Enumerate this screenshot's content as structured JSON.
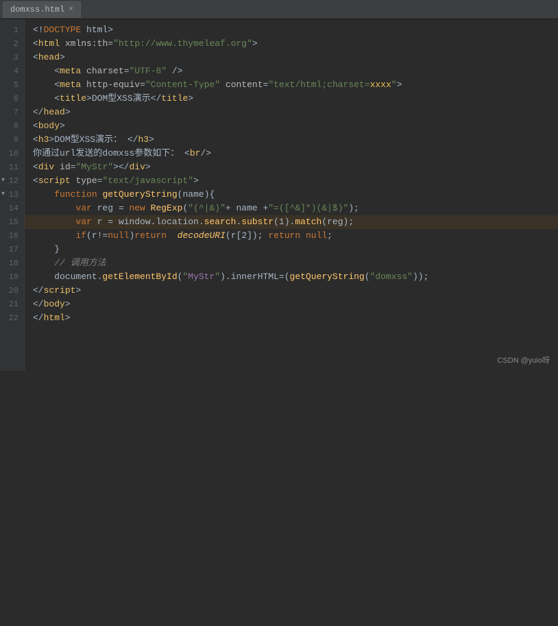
{
  "tab": {
    "filename": "domxss.html",
    "close": "×"
  },
  "lines": [
    {
      "num": 1,
      "fold": false,
      "highlighted": false
    },
    {
      "num": 2,
      "fold": false,
      "highlighted": false
    },
    {
      "num": 3,
      "fold": false,
      "highlighted": false
    },
    {
      "num": 4,
      "fold": false,
      "highlighted": false
    },
    {
      "num": 5,
      "fold": false,
      "highlighted": false
    },
    {
      "num": 6,
      "fold": false,
      "highlighted": false
    },
    {
      "num": 7,
      "fold": false,
      "highlighted": false
    },
    {
      "num": 8,
      "fold": false,
      "highlighted": false
    },
    {
      "num": 9,
      "fold": false,
      "highlighted": false
    },
    {
      "num": 10,
      "fold": false,
      "highlighted": false
    },
    {
      "num": 11,
      "fold": false,
      "highlighted": false
    },
    {
      "num": 12,
      "fold": true,
      "highlighted": false
    },
    {
      "num": 13,
      "fold": true,
      "highlighted": false
    },
    {
      "num": 14,
      "fold": false,
      "highlighted": false
    },
    {
      "num": 15,
      "fold": false,
      "highlighted": true
    },
    {
      "num": 16,
      "fold": false,
      "highlighted": false
    },
    {
      "num": 17,
      "fold": false,
      "highlighted": false
    },
    {
      "num": 18,
      "fold": false,
      "highlighted": false
    },
    {
      "num": 19,
      "fold": false,
      "highlighted": false
    },
    {
      "num": 20,
      "fold": false,
      "highlighted": false
    },
    {
      "num": 21,
      "fold": false,
      "highlighted": false
    },
    {
      "num": 22,
      "fold": false,
      "highlighted": false
    }
  ],
  "watermark": "CSDN @yuio呀"
}
